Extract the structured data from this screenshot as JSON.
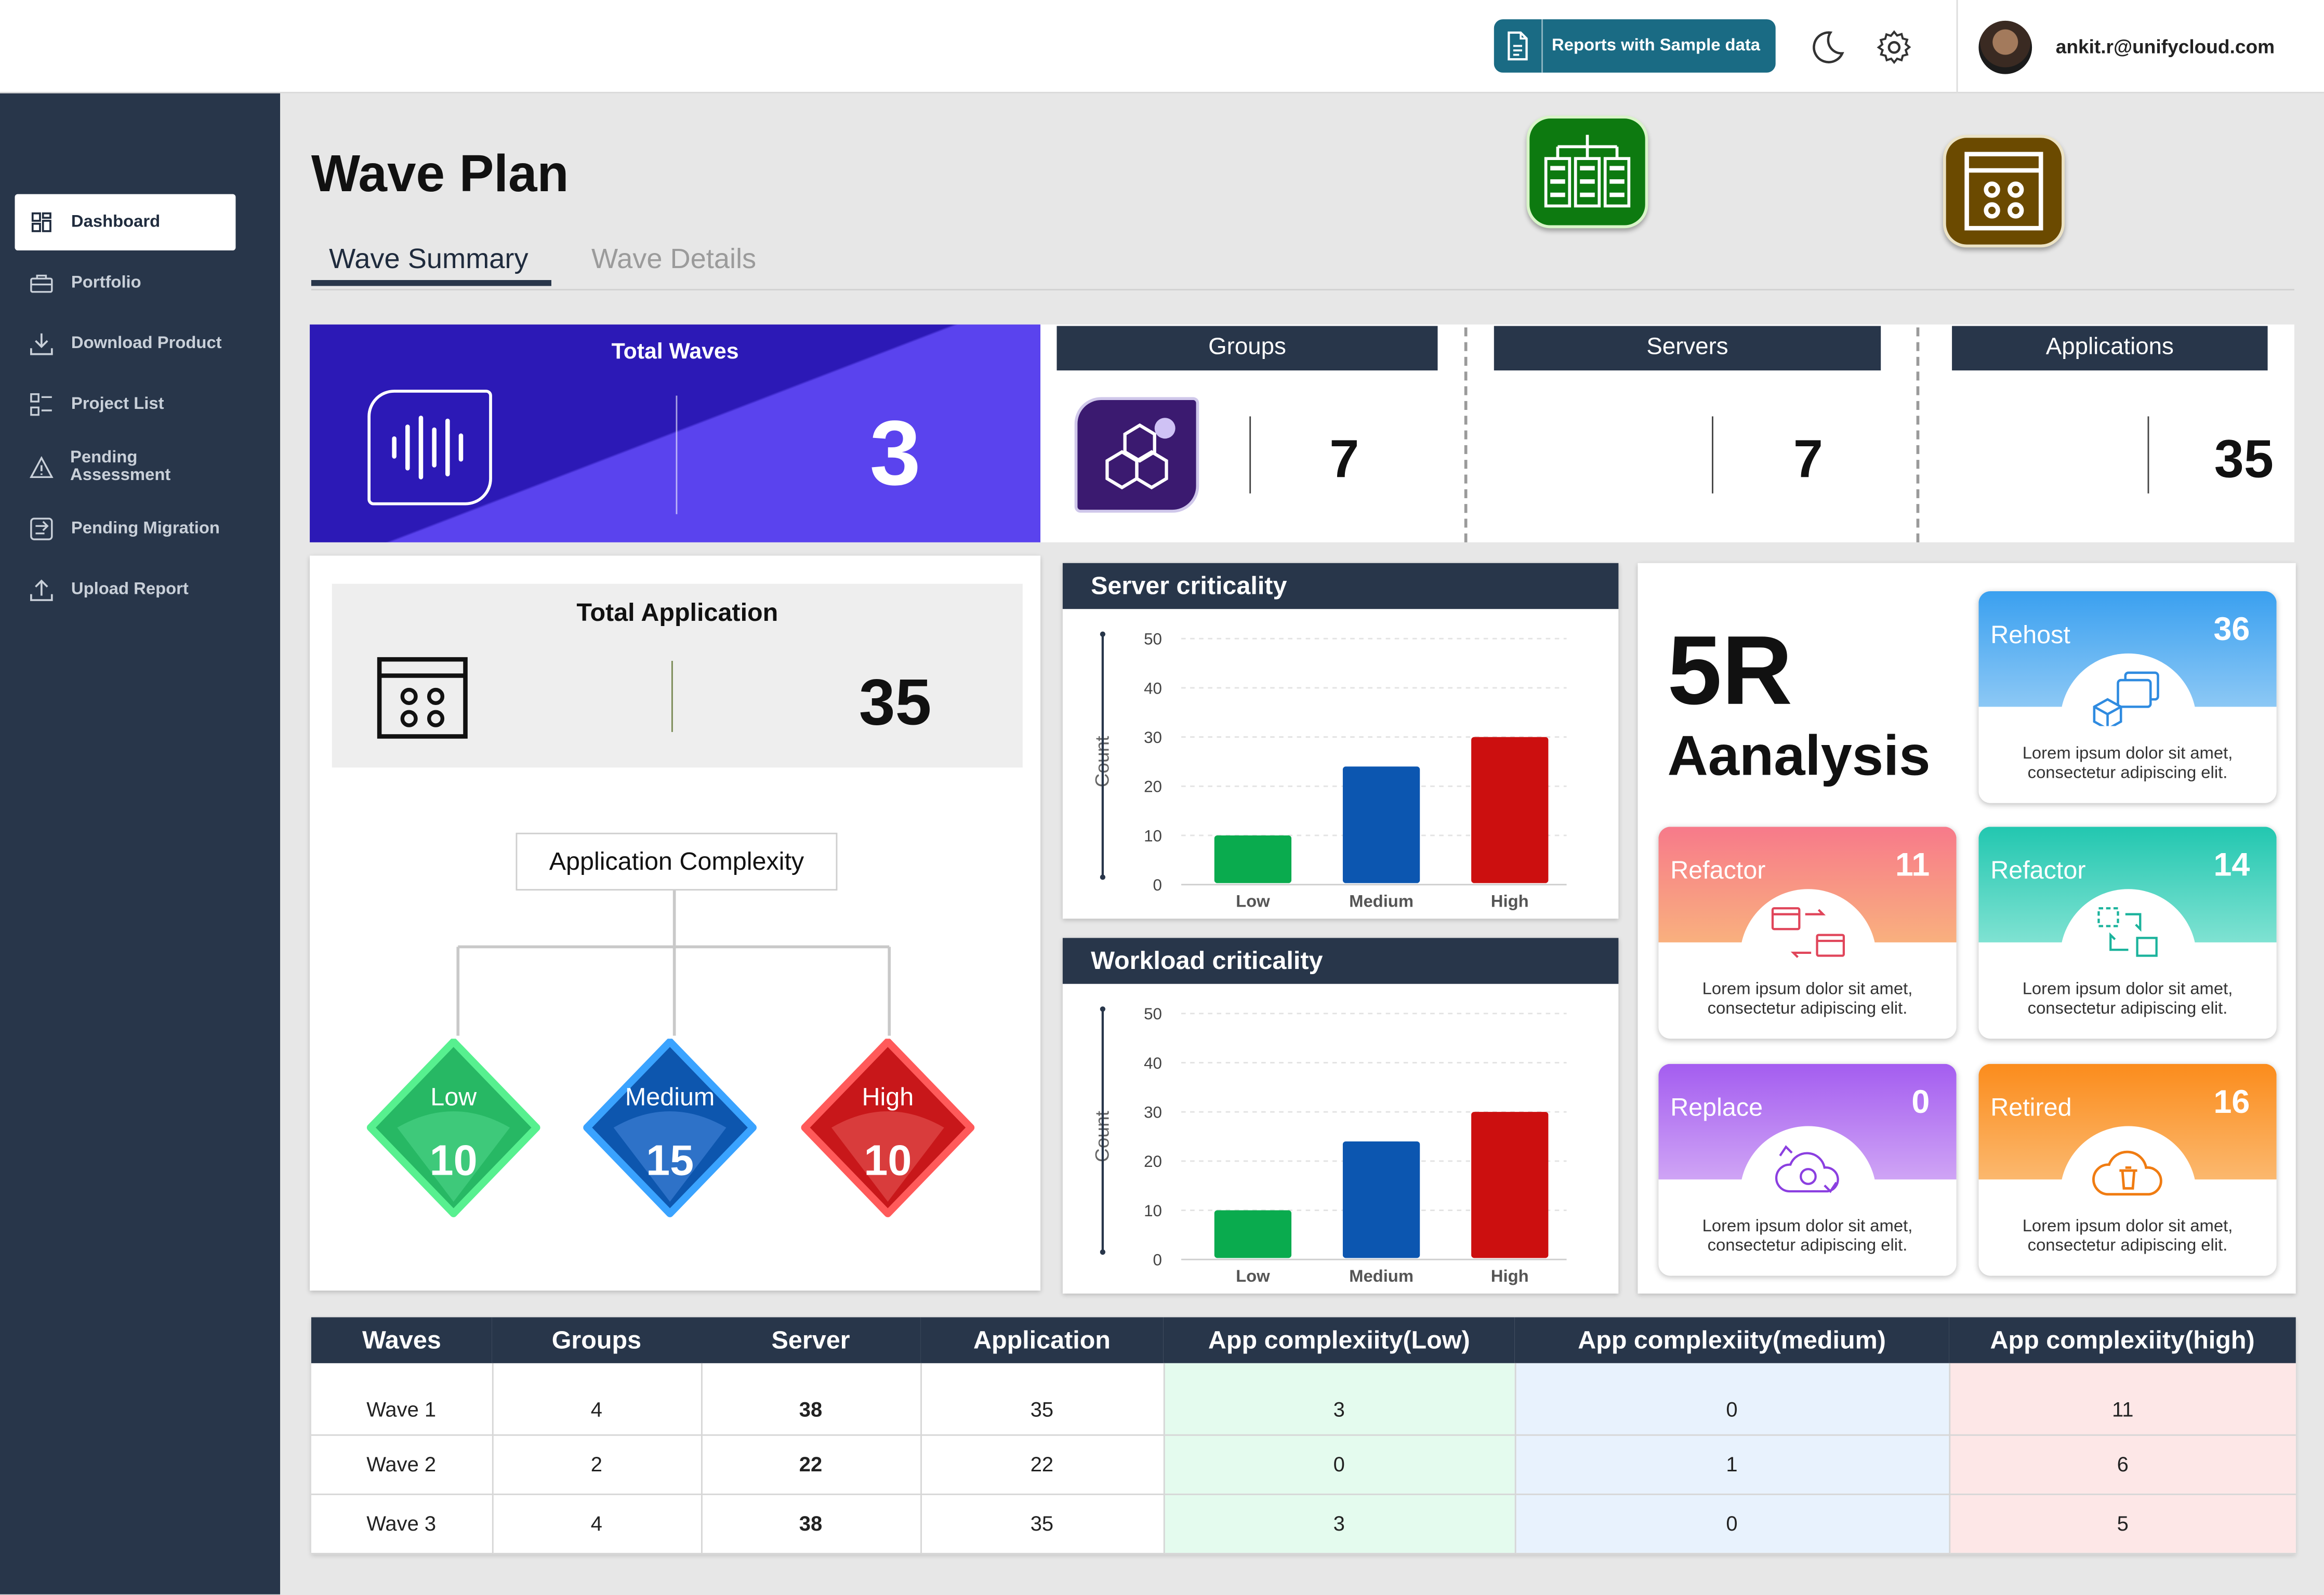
{
  "topbar": {
    "reports_button_label": "Reports with Sample data",
    "user_email": "ankit.r@unifycloud.com"
  },
  "sidebar": {
    "items": [
      {
        "label": "Dashboard",
        "icon": "dashboard-icon",
        "active": true
      },
      {
        "label": "Portfolio",
        "icon": "portfolio-icon"
      },
      {
        "label": "Download Product",
        "icon": "download-icon"
      },
      {
        "label": "Project List",
        "icon": "project-list-icon"
      },
      {
        "label": "Pending Assessment",
        "icon": "warning-icon"
      },
      {
        "label": "Pending Migration",
        "icon": "migration-icon"
      },
      {
        "label": "Upload Report",
        "icon": "upload-icon"
      }
    ]
  },
  "page": {
    "title": "Wave Plan",
    "tabs": [
      {
        "label": "Wave Summary",
        "active": true
      },
      {
        "label": "Wave Details",
        "active": false
      }
    ]
  },
  "stats": {
    "total_waves": {
      "label": "Total Waves",
      "value": "3"
    },
    "groups": {
      "label": "Groups",
      "value": "7"
    },
    "servers": {
      "label": "Servers",
      "value": "7"
    },
    "applications": {
      "label": "Applications",
      "value": "35"
    }
  },
  "total_application": {
    "label": "Total Application",
    "value": "35"
  },
  "complexity": {
    "title": "Application Complexity",
    "levels": [
      {
        "label": "Low",
        "value": "10",
        "color": "#22c55e"
      },
      {
        "label": "Medium",
        "value": "15",
        "color": "#1d6fd6"
      },
      {
        "label": "High",
        "value": "10",
        "color": "#e02424"
      }
    ]
  },
  "chart_data": [
    {
      "type": "bar",
      "title": "Server criticality",
      "ylabel": "Count",
      "categories": [
        "Low",
        "Medium",
        "High"
      ],
      "values": [
        10,
        24,
        30
      ],
      "colors": [
        "#0aab4e",
        "#0c56b0",
        "#cc0f0f"
      ],
      "ylim": [
        0,
        50
      ],
      "yticks": [
        0,
        10,
        20,
        30,
        40,
        50
      ],
      "grid": true
    },
    {
      "type": "bar",
      "title": "Workload criticality",
      "ylabel": "Count",
      "categories": [
        "Low",
        "Medium",
        "High"
      ],
      "values": [
        10,
        24,
        30
      ],
      "colors": [
        "#0aab4e",
        "#0c56b0",
        "#cc0f0f"
      ],
      "ylim": [
        0,
        50
      ],
      "yticks": [
        0,
        10,
        20,
        30,
        40,
        50
      ],
      "grid": true
    }
  ],
  "analysis": {
    "title_line1": "5R",
    "title_line2": "Aanalysis",
    "cards": [
      {
        "name": "Rehost",
        "count": "36",
        "desc1": "Lorem ipsum dolor sit amet,",
        "desc2": "consectetur adipiscing elit.",
        "icon": "rehost-icon"
      },
      {
        "name": "Refactor",
        "count": "11",
        "desc1": "Lorem ipsum dolor sit amet,",
        "desc2": "consectetur adipiscing elit.",
        "icon": "refactor-icon"
      },
      {
        "name": "Refactor",
        "count": "14",
        "desc1": "Lorem ipsum dolor sit amet,",
        "desc2": "consectetur adipiscing elit.",
        "icon": "refactor-alt-icon"
      },
      {
        "name": "Replace",
        "count": "0",
        "desc1": "Lorem ipsum dolor sit amet,",
        "desc2": "consectetur adipiscing elit.",
        "icon": "replace-icon"
      },
      {
        "name": "Retired",
        "count": "16",
        "desc1": "Lorem ipsum dolor sit amet,",
        "desc2": "consectetur adipiscing elit.",
        "icon": "retired-icon"
      }
    ]
  },
  "table": {
    "headers": [
      "Waves",
      "Groups",
      "Server",
      "Application",
      "App complexiity(Low)",
      "App complexiity(medium)",
      "App complexiity(high)"
    ],
    "rows": [
      [
        "Wave 1",
        "4",
        "38",
        "35",
        "3",
        "0",
        "11"
      ],
      [
        "Wave 2",
        "2",
        "22",
        "22",
        "0",
        "1",
        "6"
      ],
      [
        "Wave 3",
        "4",
        "38",
        "35",
        "3",
        "0",
        "5"
      ]
    ]
  }
}
